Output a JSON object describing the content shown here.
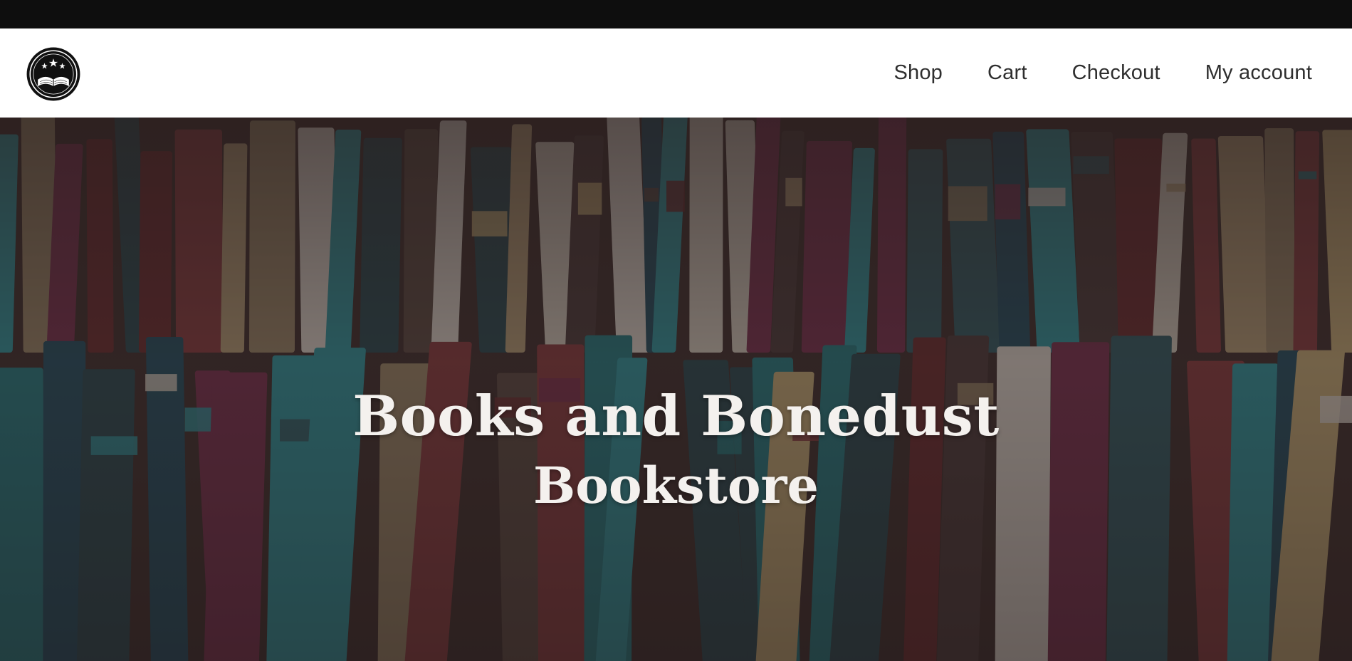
{
  "logo": {
    "icon": "open-book-stars-seal-icon",
    "color": "#111111"
  },
  "nav": {
    "items": [
      {
        "label": "Shop"
      },
      {
        "label": "Cart"
      },
      {
        "label": "Checkout"
      },
      {
        "label": "My account"
      }
    ]
  },
  "hero": {
    "title": "Books and Bonedust",
    "subtitle": "Bookstore",
    "background": "bookshelf-photo"
  }
}
